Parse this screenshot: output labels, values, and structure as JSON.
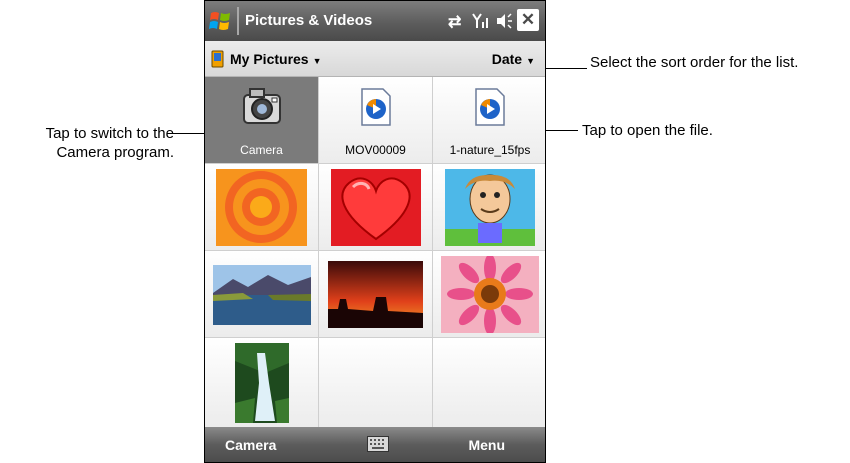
{
  "window": {
    "title": "Pictures & Videos",
    "close_label": "✕"
  },
  "nav": {
    "folder_label": "My Pictures",
    "folder_caret": "▼",
    "sort_label": "Date",
    "sort_caret": "▼"
  },
  "grid": {
    "items": [
      {
        "label": "Camera"
      },
      {
        "label": "MOV00009"
      },
      {
        "label": "1-nature_15fps"
      }
    ]
  },
  "softkeys": {
    "left_label": "Camera",
    "right_label": "Menu"
  },
  "callouts": {
    "camera": "Tap to switch to the Camera program.",
    "sort": "Select the sort order for the list.",
    "open_file": "Tap to open the file."
  },
  "icons": {
    "start": "windows-logo-icon",
    "connectivity": "sync-arrows-icon",
    "signal": "signal-strength-icon",
    "volume": "speaker-icon",
    "close": "close-icon",
    "folder": "device-icon",
    "camera": "camera-icon",
    "video": "video-file-icon",
    "keyboard": "keyboard-icon"
  },
  "colors": {
    "titlebar": "#5d5d5d",
    "selected_cell": "#7b7b7b",
    "navbar": "#e0e0e0"
  }
}
